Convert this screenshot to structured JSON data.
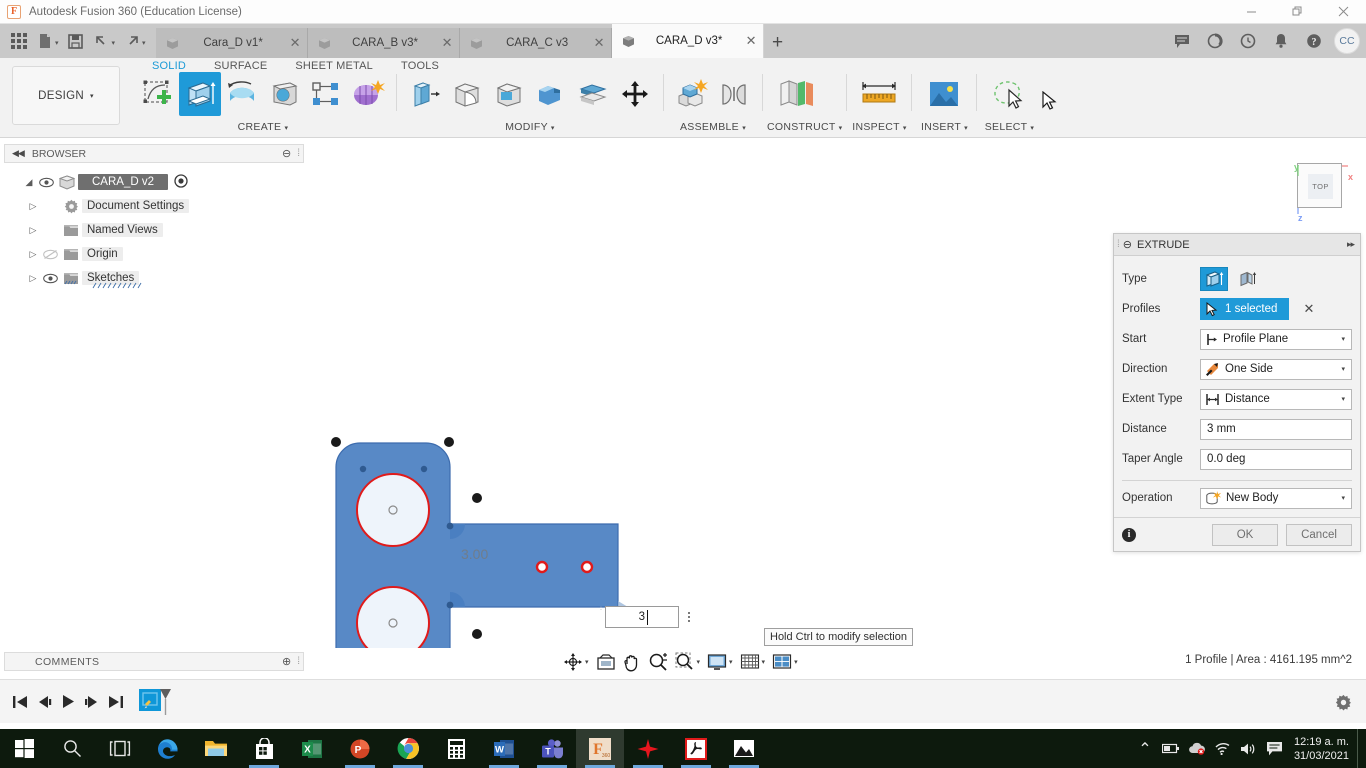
{
  "window": {
    "title": "Autodesk Fusion 360 (Education License)",
    "logo_letter": "F",
    "minimize": "—",
    "maximize": "❐",
    "close": "✕"
  },
  "quick_access": {
    "app_grid": "app-grid",
    "new_caret": "▾",
    "undo_caret": "▾",
    "redo_caret": "▾"
  },
  "tabs": [
    {
      "label": "Cara_D v1*",
      "close": "✕",
      "active": false
    },
    {
      "label": "CARA_B v3*",
      "close": "✕",
      "active": false
    },
    {
      "label": "CARA_C v3",
      "close": "✕",
      "active": false
    },
    {
      "label": "CARA_D v3*",
      "close": "✕",
      "active": true
    }
  ],
  "tab_add": "+",
  "header_right": {
    "avatar_initials": "CC"
  },
  "ribbon": {
    "design_label": "DESIGN",
    "design_caret": "▾",
    "env_tabs": [
      {
        "label": "SOLID",
        "active": true
      },
      {
        "label": "SURFACE",
        "active": false
      },
      {
        "label": "SHEET METAL",
        "active": false
      },
      {
        "label": "TOOLS",
        "active": false
      }
    ],
    "panels": [
      {
        "label": "CREATE",
        "caret": "▾"
      },
      {
        "label": "MODIFY",
        "caret": "▾"
      },
      {
        "label": "ASSEMBLE",
        "caret": "▾"
      },
      {
        "label": "CONSTRUCT",
        "caret": "▾"
      },
      {
        "label": "INSPECT",
        "caret": "▾"
      },
      {
        "label": "INSERT",
        "caret": "▾"
      },
      {
        "label": "SELECT",
        "caret": "▾"
      }
    ]
  },
  "browser": {
    "title": "BROWSER",
    "collapse": "◀◀",
    "tree": [
      {
        "label": "CARA_D v2",
        "arrow": "◢",
        "root": true
      },
      {
        "label": "Document Settings",
        "arrow": "▷"
      },
      {
        "label": "Named Views",
        "arrow": "▷"
      },
      {
        "label": "Origin",
        "arrow": "▷"
      },
      {
        "label": "Sketches",
        "arrow": "▷"
      }
    ]
  },
  "viewcube": {
    "face": "TOP",
    "axis_x": "x",
    "axis_y": "y",
    "axis_z": "z"
  },
  "canvas": {
    "dimension_label": "3.00",
    "inline_value": "3",
    "tooltip": "Hold Ctrl to modify selection"
  },
  "extrude": {
    "title": "EXTRUDE",
    "minimize": "⊖",
    "expand": "▸▸",
    "rows": {
      "type_label": "Type",
      "profiles_label": "Profiles",
      "profiles_value": "1 selected",
      "profiles_clear": "✕",
      "start_label": "Start",
      "start_value": "Profile Plane",
      "direction_label": "Direction",
      "direction_value": "One Side",
      "extent_label": "Extent Type",
      "extent_value": "Distance",
      "distance_label": "Distance",
      "distance_value": "3 mm",
      "taper_label": "Taper Angle",
      "taper_value": "0.0 deg",
      "operation_label": "Operation",
      "operation_value": "New Body"
    },
    "caret": "▾",
    "info": "i",
    "ok": "OK",
    "cancel": "Cancel"
  },
  "bottom": {
    "comments_title": "COMMENTS",
    "comments_add": "⊕",
    "status": "1 Profile | Area : 4161.195 mm^2",
    "nav_icons": [
      "orbit-icon",
      "look-at-icon",
      "pan-icon",
      "zoom-icon",
      "zoom-window-icon",
      "display-settings-icon",
      "grid-snap-icon",
      "viewports-icon"
    ],
    "timeline_buttons": [
      "go-to-beginning-icon",
      "step-back-icon",
      "play-icon",
      "step-forward-icon",
      "go-to-end-icon"
    ],
    "timeline_feature": "sketch-feature-icon",
    "settings": "gear-icon"
  },
  "taskbar": {
    "items": [
      "start-icon",
      "search-icon",
      "task-view-icon",
      "edge-icon",
      "file-explorer-icon",
      "microsoft-store-icon",
      "excel-icon",
      "powerpoint-icon",
      "chrome-icon",
      "calculator-icon",
      "word-icon",
      "teams-icon",
      "fusion360-icon",
      "star-app-icon",
      "acrobat-icon",
      "photos-icon"
    ],
    "tray": {
      "chevron": "⌃",
      "battery": "battery-icon",
      "onedrive": "onedrive-error-icon",
      "wifi": "wifi-icon",
      "volume": "volume-icon",
      "action_center": "action-center-icon"
    },
    "time": "12:19 a. m.",
    "date": "31/03/2021"
  }
}
